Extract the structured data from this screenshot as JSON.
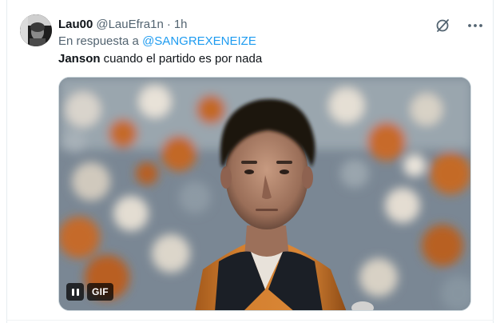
{
  "tweet": {
    "author_name": "Lau00",
    "author_handle": "@LauEfra1n",
    "separator": "·",
    "timestamp": "1h",
    "reply_prefix": "En respuesta a ",
    "reply_mention": "@SANGREXENEIZE",
    "text_bold": "Janson",
    "text_rest": " cuando el partido es por nada"
  },
  "media": {
    "type": "gif",
    "badge_label": "GIF",
    "control_state": "playing"
  },
  "icons": {
    "avatar": "user-avatar",
    "grok": "grok-icon",
    "more": "more-options-icon",
    "pause": "pause-icon"
  },
  "colors": {
    "link": "#1d9bf0",
    "secondary_text": "#536471",
    "primary_text": "#0f1419"
  }
}
